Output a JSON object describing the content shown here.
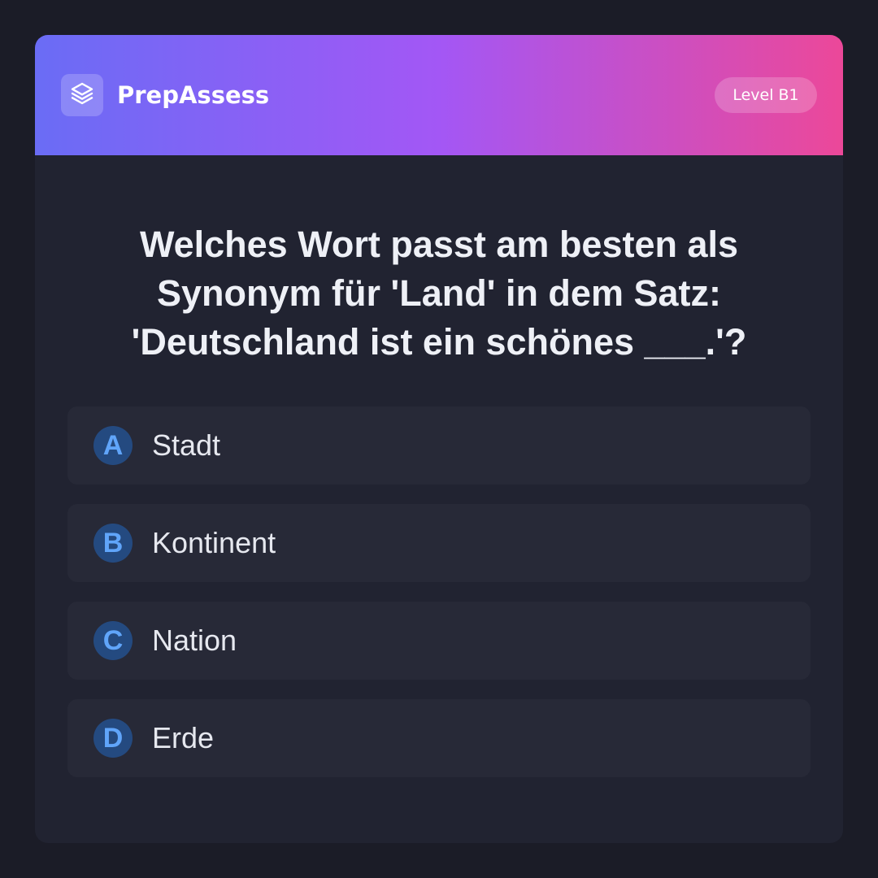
{
  "header": {
    "brand": "PrepAssess",
    "logo_icon": "layers-icon",
    "level": "Level B1"
  },
  "question": {
    "text": "Welches Wort passt am besten als Synonym für 'Land' in dem Satz: 'Deutschland ist ein schönes ___.'?"
  },
  "options": [
    {
      "letter": "A",
      "text": "Stadt"
    },
    {
      "letter": "B",
      "text": "Kontinent"
    },
    {
      "letter": "C",
      "text": "Nation"
    },
    {
      "letter": "D",
      "text": "Erde"
    }
  ],
  "colors": {
    "background": "#1b1c27",
    "card": "#212331",
    "header_gradient": [
      "#6a6cf5",
      "#a357f5",
      "#ec4899"
    ],
    "option_bg": "#272937",
    "letter_bg": "#244a80",
    "letter_fg": "#60a5fa"
  }
}
